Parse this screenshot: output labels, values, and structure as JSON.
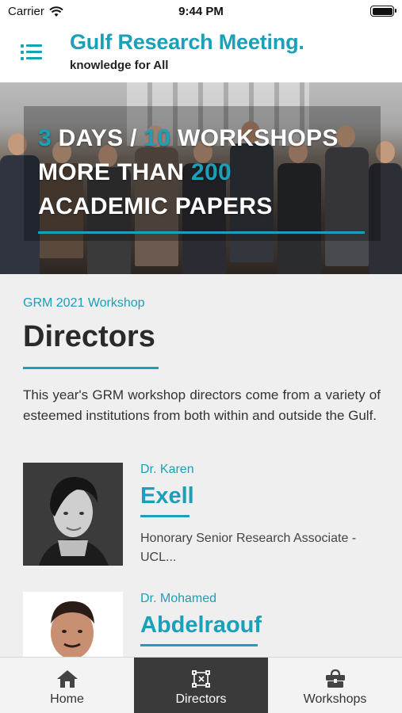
{
  "status_bar": {
    "carrier": "Carrier",
    "time": "9:44 PM"
  },
  "header": {
    "title": "Gulf Research Meeting.",
    "subtitle": "knowledge for All"
  },
  "hero": {
    "line1": {
      "num": "3",
      "text_a": " DAYS / ",
      "num2": "10",
      "text_b": " WORKSHOPS"
    },
    "line2": {
      "text": "MORE THAN ",
      "num": "200"
    },
    "line3": {
      "text": "ACADEMIC PAPERS"
    }
  },
  "section": {
    "kicker": "GRM 2021 Workshop",
    "title": "Directors",
    "intro": "This year's GRM workshop directors come from a variety of esteemed institutions from both within and outside the Gulf."
  },
  "directors": [
    {
      "prefix": "Dr. Karen",
      "name": "Exell",
      "role": "Honorary Senior Research Associate - UCL..."
    },
    {
      "prefix": "Dr. Mohamed",
      "name": "Abdelraouf",
      "role": ""
    }
  ],
  "tabs": [
    {
      "label": "Home",
      "icon": "home-icon",
      "active": false
    },
    {
      "label": "Directors",
      "icon": "directors-icon",
      "active": true
    },
    {
      "label": "Workshops",
      "icon": "workshops-icon",
      "active": false
    }
  ],
  "colors": {
    "accent": "#1aa0b8",
    "active_tab": "#3a3a3a",
    "text": "#2a2a2a"
  }
}
